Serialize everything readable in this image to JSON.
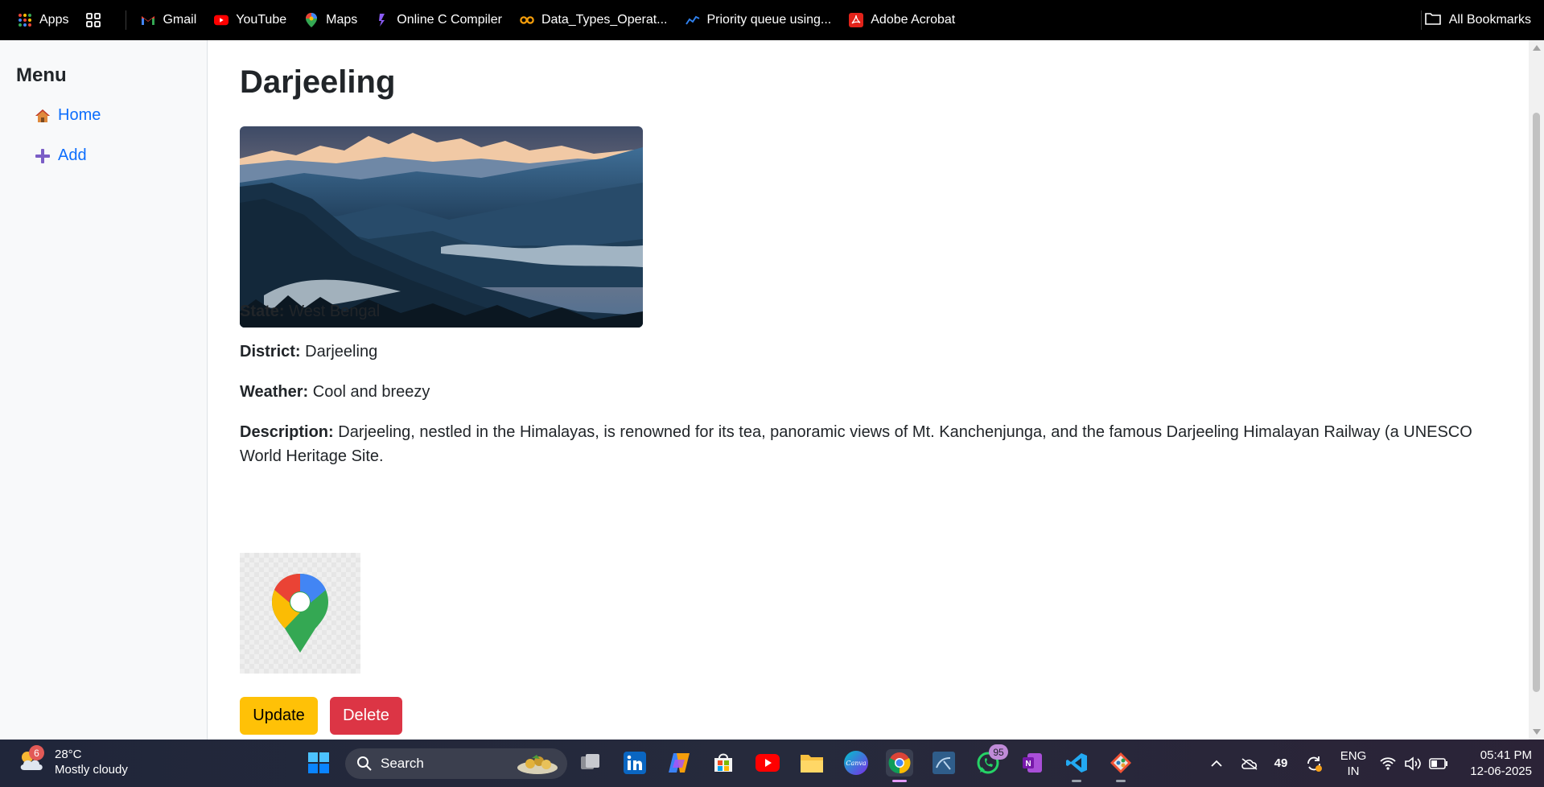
{
  "bookmarks": {
    "items": [
      {
        "label": "Apps"
      },
      {
        "label": "Gmail"
      },
      {
        "label": "YouTube"
      },
      {
        "label": "Maps"
      },
      {
        "label": "Online C Compiler"
      },
      {
        "label": "Data_Types_Operat..."
      },
      {
        "label": "Priority queue using..."
      },
      {
        "label": "Adobe Acrobat"
      }
    ],
    "all_bookmarks": "All Bookmarks"
  },
  "sidebar": {
    "title": "Menu",
    "items": [
      {
        "label": "Home",
        "icon": "house-icon"
      },
      {
        "label": "Add",
        "icon": "plus-icon"
      }
    ]
  },
  "place": {
    "title": "Darjeeling",
    "state_label": "State:",
    "state": "West Bengal",
    "district_label": "District:",
    "district": "Darjeeling",
    "weather_label": "Weather:",
    "weather": "Cool and breezy",
    "description_label": "Description:",
    "description": "Darjeeling, nestled in the Himalayas, is renowned for its tea, panoramic views of Mt. Kanchenjunga, and the famous Darjeeling Himalayan Railway (a UNESCO World Heritage Site.",
    "update_label": "Update",
    "delete_label": "Delete"
  },
  "taskbar": {
    "weather_badge": "6",
    "temperature": "28°C",
    "condition": "Mostly cloudy",
    "search_placeholder": "Search",
    "whatsapp_badge": "95",
    "tray_number": "49",
    "lang_line1": "ENG",
    "lang_line2": "IN",
    "time": "05:41 PM",
    "date": "12-06-2025"
  },
  "colors": {
    "primary_link": "#0d6efd",
    "update_button": "#ffc107",
    "delete_button": "#dc3545",
    "sidebar_bg": "#f8f9fa"
  }
}
